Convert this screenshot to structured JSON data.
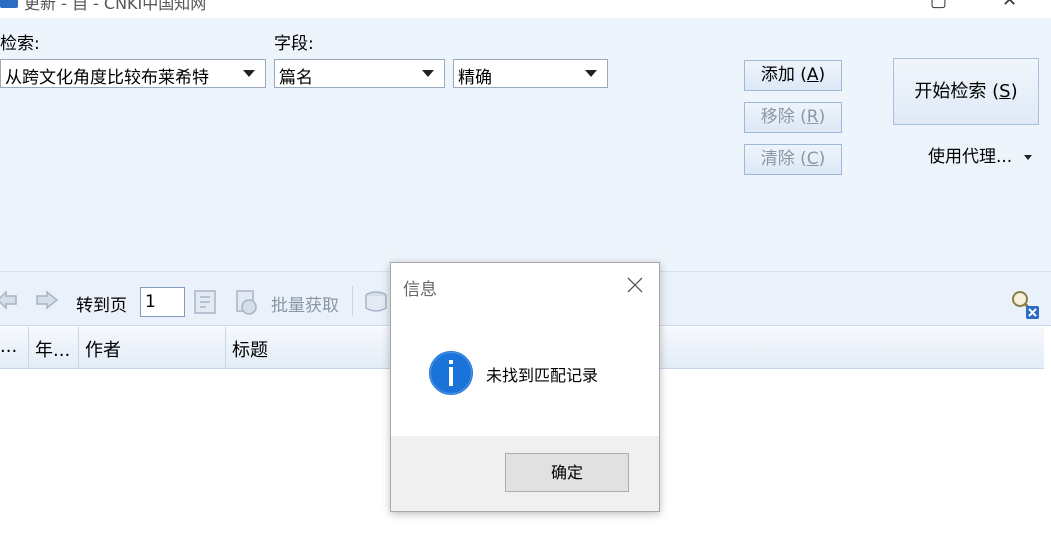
{
  "window": {
    "title": "更新 - 自 - CNKI中国知网",
    "min_icon": "minimize-icon",
    "close_icon": "close-icon"
  },
  "search": {
    "query_label": "检索:",
    "field_label": "字段:",
    "query_value": "从跨文化角度比较布莱希特",
    "field_value": "篇名",
    "match_value": "精确",
    "add_label": "添加 (",
    "add_key": "A",
    "remove_label": "移除 (",
    "remove_key": "R",
    "clear_label": "清除 (",
    "clear_key": "C",
    "start_label": "开始检索 (",
    "start_key": "S",
    "proxy_label": "使用代理..."
  },
  "toolbar": {
    "goto_label": "转到页",
    "page_value": "1",
    "batch_label": "批量获取"
  },
  "grid": {
    "columns": [
      "...",
      "年...",
      "作者",
      "标题"
    ]
  },
  "dialog": {
    "title": "信息",
    "message": "未找到匹配记录",
    "ok_label": "确定",
    "icon": "info-icon"
  },
  "colors": {
    "panel_bg": "#eef4fb",
    "info_blue": "#1a73d9",
    "accent": "#2b6cc4"
  }
}
